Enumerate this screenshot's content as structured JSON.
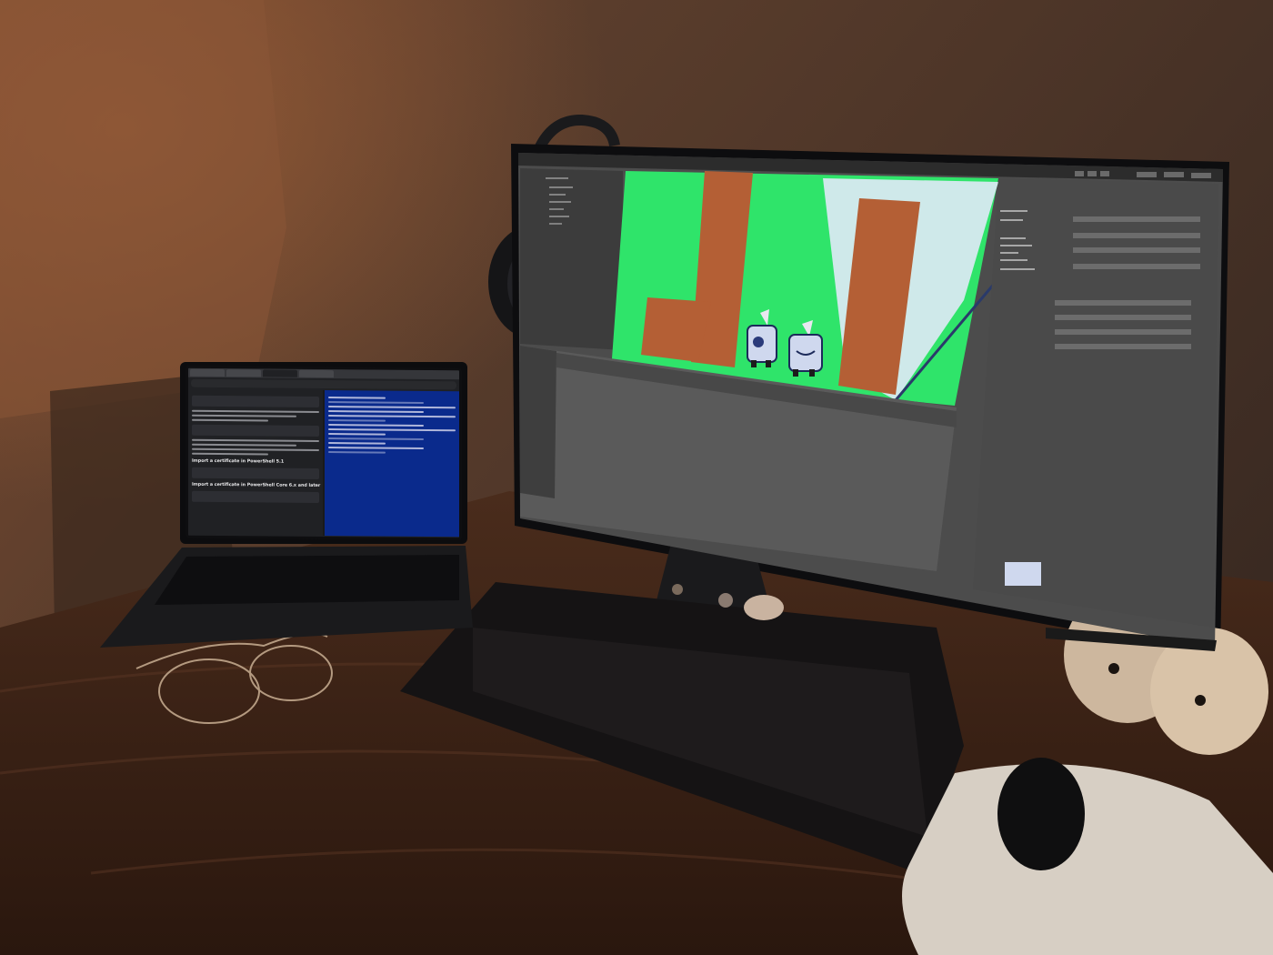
{
  "laptop": {
    "heading_ps51": "Import a certificate in PowerShell 5.1",
    "heading_ps6": "Import a certificate in PowerShell Core 6.x and later"
  },
  "palette": {
    "wall": "#4a3428",
    "desk": "#3a2418",
    "game_green": "#2fe46a",
    "game_brown": "#b45f35",
    "game_sky": "#cfe9ea",
    "powershell_blue": "#0a2a8c",
    "editor_gray": "#5a5a5a"
  }
}
